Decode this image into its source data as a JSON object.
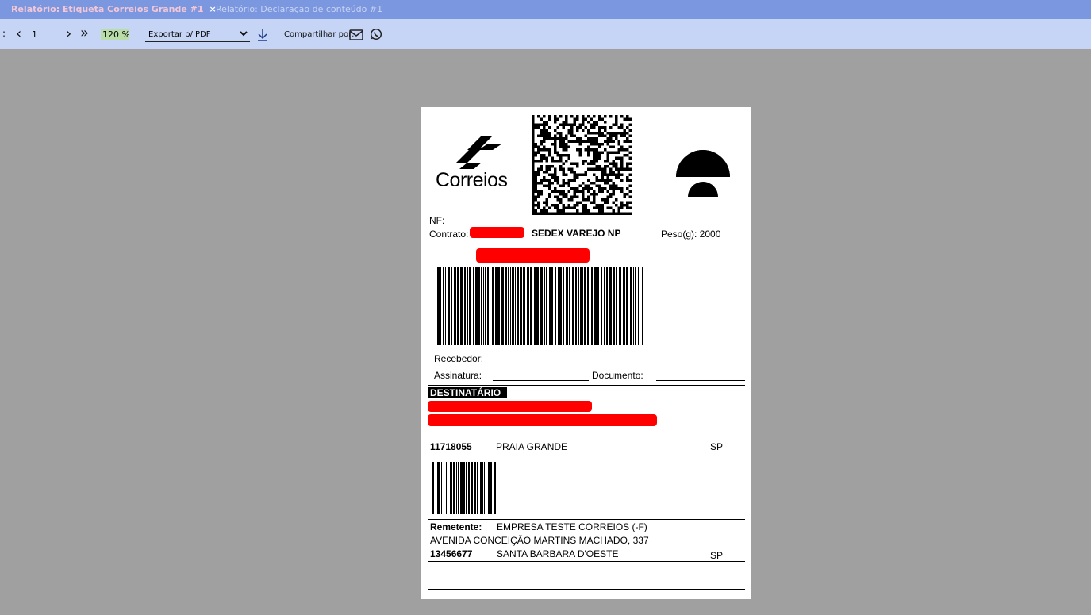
{
  "tabs": [
    {
      "label": "Relatório: Etiqueta Correios Grande #1",
      "close": "×",
      "active": true
    },
    {
      "label": "Relatório: Declaração de conteúdo #1",
      "active": false
    }
  ],
  "toolbar": {
    "prev_glyph": "‹",
    "page_value": "1",
    "next_glyph": "›",
    "last_glyph": "»",
    "zoom_value": "120 %",
    "export_value": "Exportar p/ PDF",
    "share_label": "Compartilhar por:",
    "icons": [
      "chevron-left-icon",
      "chevron-right-icon",
      "double-chevron-right-icon",
      "chevron-down-icon",
      "download-icon",
      "email-icon",
      "whatsapp-icon"
    ]
  },
  "label": {
    "brand_logo_text": "Correios",
    "nf_label": "NF:",
    "contract_label": "Contrato:",
    "service": "SEDEX VAREJO NP",
    "weight_label": "Peso(g): 2000",
    "receiver_label": "Recebedor:",
    "signature_label": "Assinatura:",
    "document_label": "Documento:",
    "recipient_header": "DESTINATÁRIO",
    "recipient_cep": "11718055",
    "recipient_city": "PRAIA GRANDE",
    "recipient_state": "SP",
    "sender_label": "Remetente:",
    "sender_name": "EMPRESA TESTE CORREIOS (-F)",
    "sender_address": "AVENIDA CONCEIÇÃO MARTINS MACHADO, 337",
    "sender_cep": "13456677",
    "sender_city": "SANTA BARBARA D'OESTE",
    "sender_state": "SP"
  },
  "colors": {
    "tabbar": "#7b97e0",
    "toolbar": "#c6d5f6",
    "viewer_bg": "#a0a0a0",
    "redaction": "#ff0000",
    "active_tab_text": "#f4c7d6"
  }
}
